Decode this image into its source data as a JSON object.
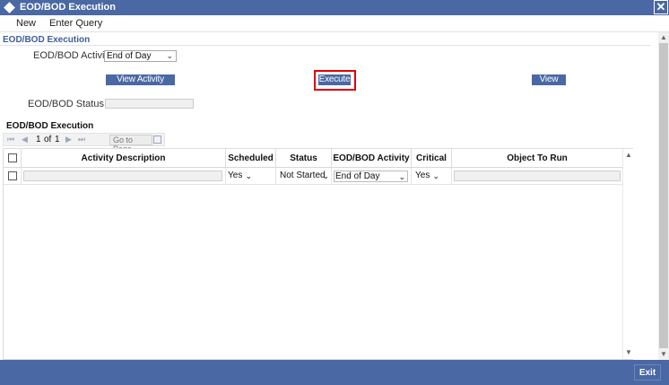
{
  "window": {
    "title": "EOD/BOD Execution",
    "close_glyph": "✕"
  },
  "menu": {
    "items": [
      "New",
      "Enter Query"
    ]
  },
  "section": {
    "title": "EOD/BOD Execution"
  },
  "form": {
    "activity_label": "EOD/BOD Activity",
    "activity_value": "End of Day",
    "status_label": "EOD/BOD Status :-",
    "status_value": ""
  },
  "buttons": {
    "view_activity_status": "View Activity Status",
    "execute": "Execute",
    "view_log": "View Log",
    "exit": "Exit"
  },
  "grid": {
    "title": "EOD/BOD Execution",
    "pager": {
      "current": "1",
      "of_label": "of",
      "total": "1",
      "goto_placeholder": "Go to Page"
    },
    "columns": [
      "Activity Description",
      "Scheduled",
      "Status",
      "EOD/BOD Activity",
      "Critical",
      "Object To Run"
    ],
    "rows": [
      {
        "activity_description": "",
        "scheduled": "Yes",
        "status": "Not Started",
        "eod_bod_activity": "End of Day",
        "critical": "Yes",
        "object_to_run": ""
      }
    ]
  },
  "icons": {
    "title": "diamond-icon",
    "close": "close-icon",
    "pager_first": "first-page-icon",
    "pager_prev": "prev-page-icon",
    "pager_next": "next-page-icon",
    "pager_last": "last-page-icon",
    "goto": "grid-icon"
  },
  "colors": {
    "brand": "#4a68a3",
    "highlight": "#e30000",
    "section_title": "#3d5f9a"
  }
}
